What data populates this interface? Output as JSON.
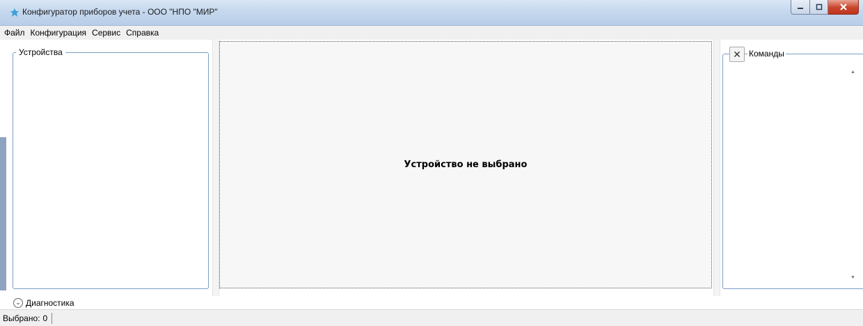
{
  "window": {
    "title": "Конфигуратор приборов учета - ООО \"НПО \"МИР\"",
    "buttons": {
      "minimize": "minimize",
      "maximize": "maximize",
      "close": "close"
    }
  },
  "menu": {
    "items": [
      "Файл",
      "Конфигурация",
      "Сервис",
      "Справка"
    ]
  },
  "panels": {
    "devices": {
      "title": "Устройства"
    },
    "center": {
      "message": "Устройство не выбрано"
    },
    "commands": {
      "title": "Команды"
    }
  },
  "diagnostics": {
    "label": "Диагностика"
  },
  "status": {
    "selected_label": "Выбрано:",
    "selected_value": "0"
  },
  "colors": {
    "titlebar": "#c5d8ee",
    "close_button": "#c9452d",
    "group_border": "#7b9dc4",
    "center_bg": "#f7f7f7"
  }
}
